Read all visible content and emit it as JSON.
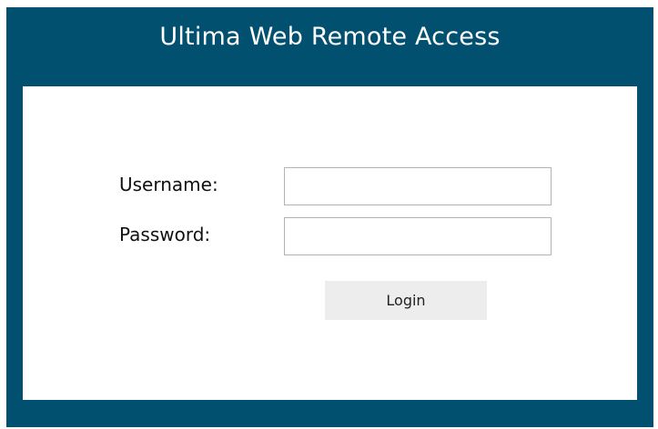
{
  "header": {
    "title": "Ultima Web Remote Access"
  },
  "form": {
    "username_label": "Username:",
    "username_value": "",
    "password_label": "Password:",
    "password_value": "",
    "login_label": "Login"
  },
  "colors": {
    "frame_background": "#02506f",
    "panel_background": "#ffffff",
    "button_background": "#ededed"
  }
}
